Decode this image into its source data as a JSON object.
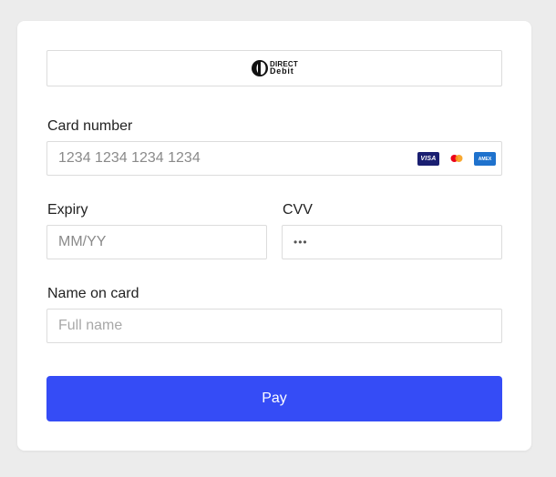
{
  "direct_debit": {
    "line1": "DIRECT",
    "line2": "Debit"
  },
  "card_number": {
    "label": "Card number",
    "placeholder": "1234 1234 1234 1234",
    "brands": [
      "VISA",
      "mastercard",
      "AMEX"
    ]
  },
  "expiry": {
    "label": "Expiry",
    "placeholder": "MM/YY"
  },
  "cvv": {
    "label": "CVV",
    "placeholder": "•••"
  },
  "name_on_card": {
    "label": "Name on card",
    "placeholder": "Full name"
  },
  "pay_button": {
    "label": "Pay"
  },
  "colors": {
    "accent": "#354cf6",
    "background": "#ececec",
    "card": "#ffffff",
    "border": "#dcdcdc"
  }
}
